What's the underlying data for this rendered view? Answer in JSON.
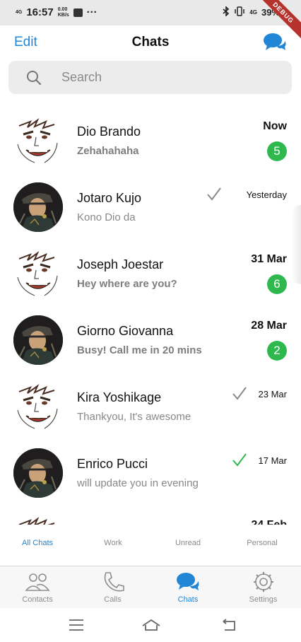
{
  "status_bar": {
    "network": "4G",
    "time": "16:57",
    "speed": "0.00",
    "speed_unit": "KB/s",
    "more": "···",
    "battery_network": "4G",
    "battery": "39%",
    "debug": "DEBUG"
  },
  "header": {
    "edit_label": "Edit",
    "title": "Chats",
    "compose_icon": "chat-bubbles-icon"
  },
  "search": {
    "placeholder": "Search",
    "icon": "search-icon"
  },
  "chats": [
    {
      "name": "Dio Brando",
      "preview": "Zehahahaha",
      "time": "Now",
      "time_bold": true,
      "unread": "5",
      "avatar": "dio-sketch",
      "check": "none"
    },
    {
      "name": "Jotaro Kujo",
      "preview": "Kono Dio da",
      "time": "Yesterday",
      "time_bold": false,
      "unread": "",
      "avatar": "jotaro-dark",
      "check": "grey"
    },
    {
      "name": "Joseph Joestar",
      "preview": "Hey where are you?",
      "time": "31 Mar",
      "time_bold": true,
      "unread": "6",
      "avatar": "dio-sketch",
      "check": "none"
    },
    {
      "name": "Giorno Giovanna",
      "preview": "Busy! Call me in 20 mins",
      "time": "28 Mar",
      "time_bold": true,
      "unread": "2",
      "avatar": "jotaro-dark",
      "check": "none"
    },
    {
      "name": "Kira Yoshikage",
      "preview": "Thankyou, It's awesome",
      "time": "23 Mar",
      "time_bold": false,
      "unread": "",
      "avatar": "dio-sketch",
      "check": "grey"
    },
    {
      "name": "Enrico Pucci",
      "preview": "will update you in evening",
      "time": "17 Mar",
      "time_bold": false,
      "unread": "",
      "avatar": "jotaro-dark",
      "check": "green"
    },
    {
      "name": "",
      "preview": "",
      "time": "24 Feb",
      "time_bold": true,
      "unread": "",
      "avatar": "dio-sketch",
      "check": "none"
    }
  ],
  "filter_tabs": [
    {
      "label": "All Chats",
      "active": true
    },
    {
      "label": "Work",
      "active": false
    },
    {
      "label": "Unread",
      "active": false
    },
    {
      "label": "Personal",
      "active": false
    }
  ],
  "bottom_nav": [
    {
      "label": "Contacts",
      "icon": "contacts-icon",
      "active": false
    },
    {
      "label": "Calls",
      "icon": "phone-icon",
      "active": false
    },
    {
      "label": "Chats",
      "icon": "chat-bubbles-icon",
      "active": true
    },
    {
      "label": "Settings",
      "icon": "gear-icon",
      "active": false
    }
  ],
  "colors": {
    "accent": "#2286d6",
    "badge": "#2fb84e",
    "check_green": "#2fb84e",
    "check_grey": "#8a8a8a"
  }
}
